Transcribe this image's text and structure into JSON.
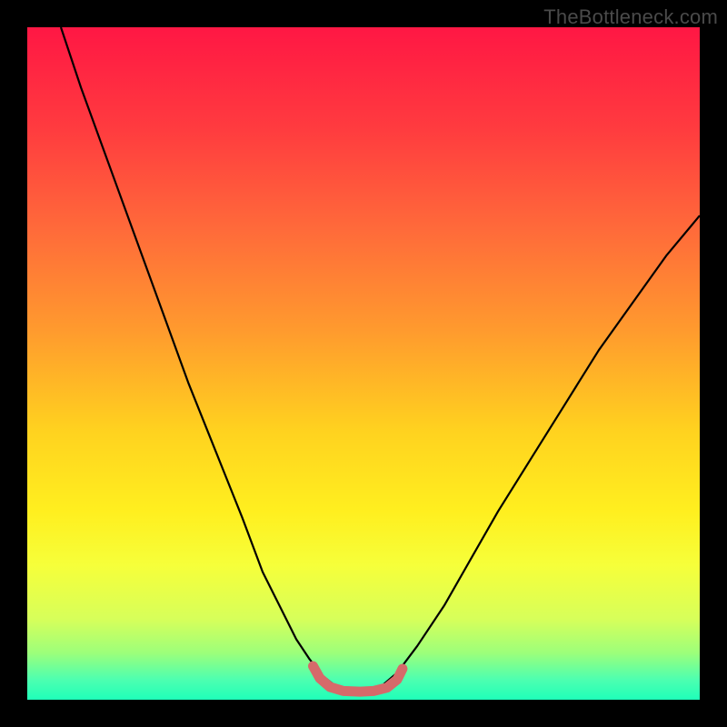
{
  "watermark": "TheBottleneck.com",
  "chart_data": {
    "type": "line",
    "title": "",
    "xlabel": "",
    "ylabel": "",
    "xlim": [
      0,
      100
    ],
    "ylim": [
      0,
      100
    ],
    "grid": false,
    "legend": false,
    "background_gradient_stops": [
      {
        "offset": 0.0,
        "color": "#ff1744"
      },
      {
        "offset": 0.15,
        "color": "#ff3b3f"
      },
      {
        "offset": 0.3,
        "color": "#ff6a3a"
      },
      {
        "offset": 0.45,
        "color": "#ff9a2e"
      },
      {
        "offset": 0.6,
        "color": "#ffd21f"
      },
      {
        "offset": 0.72,
        "color": "#ffef1f"
      },
      {
        "offset": 0.8,
        "color": "#f6ff3a"
      },
      {
        "offset": 0.88,
        "color": "#d7ff5a"
      },
      {
        "offset": 0.93,
        "color": "#9dff7a"
      },
      {
        "offset": 0.97,
        "color": "#4dffb0"
      },
      {
        "offset": 1.0,
        "color": "#1fffb9"
      }
    ],
    "series": [
      {
        "name": "left-curve",
        "stroke": "#000000",
        "stroke_width": 2.2,
        "x": [
          5,
          8,
          12,
          16,
          20,
          24,
          28,
          32,
          35,
          38,
          40,
          42,
          44,
          45.5
        ],
        "y": [
          100,
          91,
          80,
          69,
          58,
          47,
          37,
          27,
          19,
          13,
          9,
          6,
          3.5,
          2.3
        ]
      },
      {
        "name": "right-curve",
        "stroke": "#000000",
        "stroke_width": 2.2,
        "x": [
          53,
          55,
          58,
          62,
          66,
          70,
          75,
          80,
          85,
          90,
          95,
          100
        ],
        "y": [
          2.3,
          4,
          8,
          14,
          21,
          28,
          36,
          44,
          52,
          59,
          66,
          72
        ]
      },
      {
        "name": "bottom-marker",
        "stroke": "#d66a6a",
        "stroke_width": 11,
        "linecap": "round",
        "x": [
          42.5,
          43.5,
          45,
          47,
          49.5,
          51.5,
          53.5,
          55,
          55.8
        ],
        "y": [
          5.0,
          3.2,
          1.9,
          1.3,
          1.2,
          1.3,
          1.8,
          3.0,
          4.6
        ]
      }
    ]
  }
}
